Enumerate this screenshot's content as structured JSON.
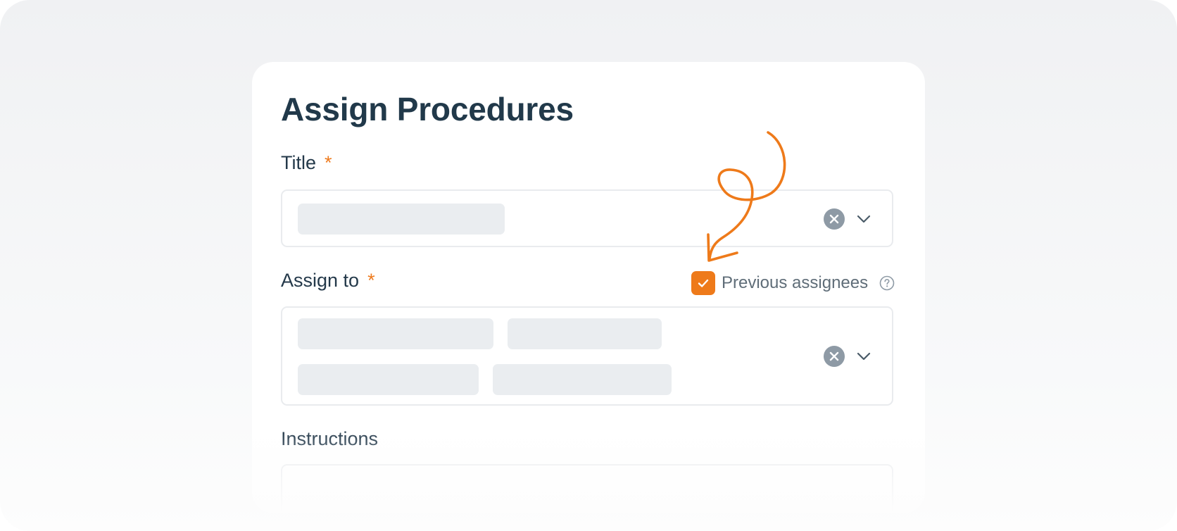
{
  "form": {
    "title": "Assign Procedures",
    "title_field": {
      "label": "Title",
      "required_mark": "*",
      "clear_icon": "clear-x-icon",
      "dropdown_icon": "chevron-down-icon"
    },
    "assign_to_field": {
      "label": "Assign to",
      "required_mark": "*",
      "clear_icon": "clear-x-icon",
      "dropdown_icon": "chevron-down-icon"
    },
    "previous_assignees": {
      "label": "Previous assignees",
      "checked": true,
      "help_icon": "question-mark-icon"
    },
    "instructions_field": {
      "label": "Instructions"
    }
  },
  "colors": {
    "accent": "#ee7a1a",
    "heading": "#21394a",
    "muted": "#8e9aa5"
  },
  "annotation": {
    "icon": "hand-drawn-arrow-icon"
  }
}
